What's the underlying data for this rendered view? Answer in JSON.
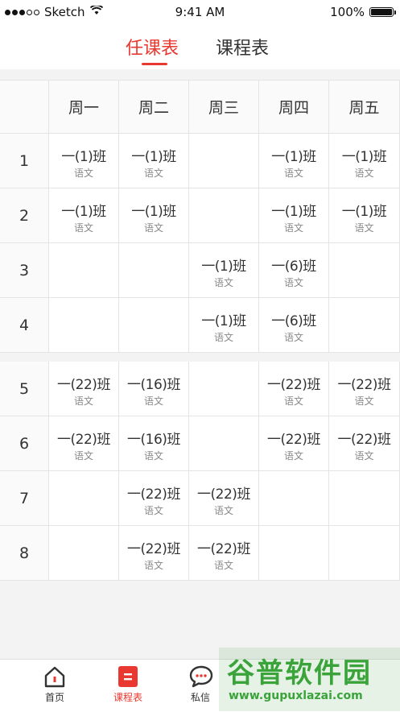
{
  "status_bar": {
    "carrier": "Sketch",
    "time": "9:41 AM",
    "battery": "100%",
    "battery_level": 1.0
  },
  "top_tabs": [
    {
      "label": "任课表",
      "active": true
    },
    {
      "label": "课程表",
      "active": false
    }
  ],
  "colors": {
    "accent": "#e8382f"
  },
  "schedule": {
    "days": [
      "周一",
      "周二",
      "周三",
      "周四",
      "周五"
    ],
    "morning_periods": [
      {
        "number": "1",
        "cells": [
          {
            "class_name": "一(1)班",
            "subject": "语文"
          },
          {
            "class_name": "一(1)班",
            "subject": "语文"
          },
          {
            "class_name": "",
            "subject": ""
          },
          {
            "class_name": "一(1)班",
            "subject": "语文"
          },
          {
            "class_name": "一(1)班",
            "subject": "语文"
          }
        ]
      },
      {
        "number": "2",
        "cells": [
          {
            "class_name": "一(1)班",
            "subject": "语文"
          },
          {
            "class_name": "一(1)班",
            "subject": "语文"
          },
          {
            "class_name": "",
            "subject": ""
          },
          {
            "class_name": "一(1)班",
            "subject": "语文"
          },
          {
            "class_name": "一(1)班",
            "subject": "语文"
          }
        ]
      },
      {
        "number": "3",
        "cells": [
          {
            "class_name": "",
            "subject": ""
          },
          {
            "class_name": "",
            "subject": ""
          },
          {
            "class_name": "一(1)班",
            "subject": "语文"
          },
          {
            "class_name": "一(6)班",
            "subject": "语文"
          },
          {
            "class_name": "",
            "subject": ""
          }
        ]
      },
      {
        "number": "4",
        "cells": [
          {
            "class_name": "",
            "subject": ""
          },
          {
            "class_name": "",
            "subject": ""
          },
          {
            "class_name": "一(1)班",
            "subject": "语文"
          },
          {
            "class_name": "一(6)班",
            "subject": "语文"
          },
          {
            "class_name": "",
            "subject": ""
          }
        ]
      }
    ],
    "afternoon_periods": [
      {
        "number": "5",
        "cells": [
          {
            "class_name": "一(22)班",
            "subject": "语文"
          },
          {
            "class_name": "一(16)班",
            "subject": "语文"
          },
          {
            "class_name": "",
            "subject": ""
          },
          {
            "class_name": "一(22)班",
            "subject": "语文"
          },
          {
            "class_name": "一(22)班",
            "subject": "语文"
          }
        ]
      },
      {
        "number": "6",
        "cells": [
          {
            "class_name": "一(22)班",
            "subject": "语文"
          },
          {
            "class_name": "一(16)班",
            "subject": "语文"
          },
          {
            "class_name": "",
            "subject": ""
          },
          {
            "class_name": "一(22)班",
            "subject": "语文"
          },
          {
            "class_name": "一(22)班",
            "subject": "语文"
          }
        ]
      },
      {
        "number": "7",
        "cells": [
          {
            "class_name": "",
            "subject": ""
          },
          {
            "class_name": "一(22)班",
            "subject": "语文"
          },
          {
            "class_name": "一(22)班",
            "subject": "语文"
          },
          {
            "class_name": "",
            "subject": ""
          },
          {
            "class_name": "",
            "subject": ""
          }
        ]
      },
      {
        "number": "8",
        "cells": [
          {
            "class_name": "",
            "subject": ""
          },
          {
            "class_name": "一(22)班",
            "subject": "语文"
          },
          {
            "class_name": "一(22)班",
            "subject": "语文"
          },
          {
            "class_name": "",
            "subject": ""
          },
          {
            "class_name": "",
            "subject": ""
          }
        ]
      }
    ]
  },
  "bottom_nav": [
    {
      "label": "首页",
      "icon": "home-icon",
      "active": false
    },
    {
      "label": "课程表",
      "icon": "schedule-icon",
      "active": true
    },
    {
      "label": "私信",
      "icon": "message-icon",
      "active": false
    }
  ],
  "watermark": {
    "title": "谷普软件园",
    "url": "www.gupuxlazai.com"
  }
}
